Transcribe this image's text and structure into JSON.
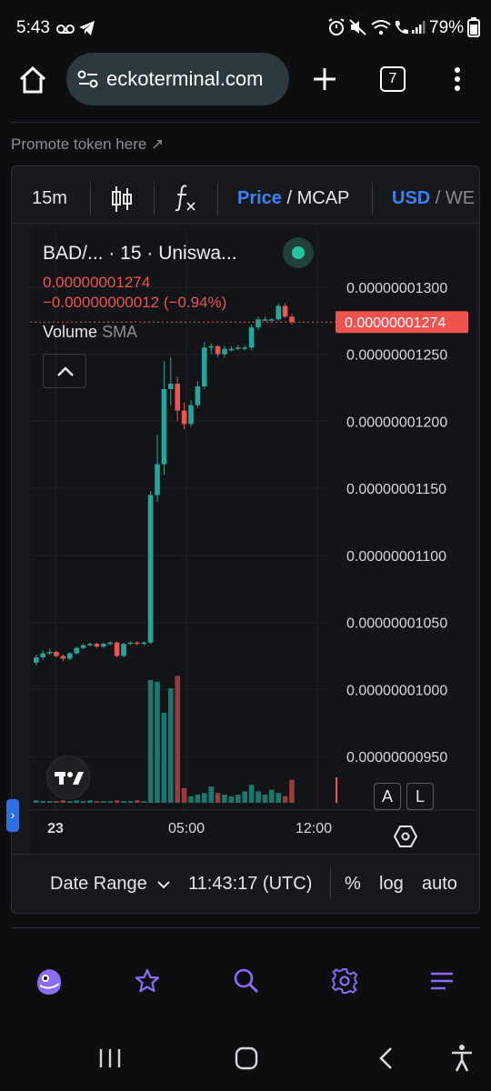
{
  "status_bar": {
    "time": "5:43",
    "battery": "79%"
  },
  "browser": {
    "url": "eckoterminal.com",
    "tab_count": "7"
  },
  "promote_link": "Promote token here ↗",
  "toolbar": {
    "interval": "15m",
    "price_label": "Price",
    "mcap_label": " / MCAP",
    "usd_label": "USD",
    "weth_label": " / WE"
  },
  "legend": {
    "symbol_line": "BAD/... · 15 · Uniswa...",
    "price": "0.00000001274",
    "change": "−0.00000000012 (−0.94%)",
    "volume_label": "Volume",
    "sma_label": "SMA"
  },
  "chart_data": {
    "type": "candlestick",
    "title": "",
    "ylim": [
      9.25e-09,
      1.325e-08
    ],
    "y_ticks": [
      "0.00000001300",
      "0.00000001250",
      "0.00000001200",
      "0.00000001150",
      "0.00000001100",
      "0.00000001050",
      "0.00000001000",
      "0.00000000950"
    ],
    "y_tick_values": [
      1300,
      1250,
      1200,
      1150,
      1100,
      1050,
      1000,
      950
    ],
    "x_ticks": [
      "23",
      "05:00",
      "12:00"
    ],
    "last_price_label": "0.00000001274",
    "last_price_value": 1274,
    "candles": [
      {
        "o": 1020,
        "c": 1024,
        "h": 1026,
        "l": 1018
      },
      {
        "o": 1024,
        "c": 1027,
        "h": 1029,
        "l": 1022
      },
      {
        "o": 1027,
        "c": 1028,
        "h": 1030,
        "l": 1026
      },
      {
        "o": 1028,
        "c": 1025,
        "h": 1029,
        "l": 1024
      },
      {
        "o": 1025,
        "c": 1023,
        "h": 1026,
        "l": 1021
      },
      {
        "o": 1023,
        "c": 1027,
        "h": 1028,
        "l": 1022
      },
      {
        "o": 1027,
        "c": 1031,
        "h": 1032,
        "l": 1026
      },
      {
        "o": 1031,
        "c": 1033,
        "h": 1034,
        "l": 1030
      },
      {
        "o": 1033,
        "c": 1034,
        "h": 1035,
        "l": 1032
      },
      {
        "o": 1034,
        "c": 1032,
        "h": 1035,
        "l": 1031
      },
      {
        "o": 1032,
        "c": 1034,
        "h": 1035,
        "l": 1031
      },
      {
        "o": 1034,
        "c": 1035,
        "h": 1036,
        "l": 1033
      },
      {
        "o": 1035,
        "c": 1025,
        "h": 1036,
        "l": 1024
      },
      {
        "o": 1025,
        "c": 1034,
        "h": 1035,
        "l": 1024
      },
      {
        "o": 1034,
        "c": 1035,
        "h": 1036,
        "l": 1033
      },
      {
        "o": 1035,
        "c": 1034,
        "h": 1036,
        "l": 1033
      },
      {
        "o": 1034,
        "c": 1035,
        "h": 1036,
        "l": 1033
      },
      {
        "o": 1035,
        "c": 1145,
        "h": 1148,
        "l": 1034
      },
      {
        "o": 1145,
        "c": 1168,
        "h": 1190,
        "l": 1140
      },
      {
        "o": 1168,
        "c": 1224,
        "h": 1245,
        "l": 1160
      },
      {
        "o": 1224,
        "c": 1228,
        "h": 1248,
        "l": 1212
      },
      {
        "o": 1228,
        "c": 1208,
        "h": 1233,
        "l": 1200
      },
      {
        "o": 1208,
        "c": 1198,
        "h": 1214,
        "l": 1194
      },
      {
        "o": 1198,
        "c": 1212,
        "h": 1216,
        "l": 1196
      },
      {
        "o": 1212,
        "c": 1226,
        "h": 1230,
        "l": 1210
      },
      {
        "o": 1226,
        "c": 1255,
        "h": 1259,
        "l": 1224
      },
      {
        "o": 1255,
        "c": 1256,
        "h": 1258,
        "l": 1250
      },
      {
        "o": 1256,
        "c": 1250,
        "h": 1257,
        "l": 1248
      },
      {
        "o": 1250,
        "c": 1254,
        "h": 1256,
        "l": 1248
      },
      {
        "o": 1254,
        "c": 1254,
        "h": 1256,
        "l": 1252
      },
      {
        "o": 1254,
        "c": 1255,
        "h": 1257,
        "l": 1253
      },
      {
        "o": 1255,
        "c": 1255,
        "h": 1257,
        "l": 1253
      },
      {
        "o": 1255,
        "c": 1270,
        "h": 1272,
        "l": 1253
      },
      {
        "o": 1270,
        "c": 1276,
        "h": 1278,
        "l": 1268
      },
      {
        "o": 1276,
        "c": 1276,
        "h": 1278,
        "l": 1275
      },
      {
        "o": 1276,
        "c": 1276,
        "h": 1277,
        "l": 1275
      },
      {
        "o": 1276,
        "c": 1286,
        "h": 1288,
        "l": 1275
      },
      {
        "o": 1286,
        "c": 1278,
        "h": 1288,
        "l": 1277
      },
      {
        "o": 1278,
        "c": 1274,
        "h": 1280,
        "l": 1272
      }
    ],
    "volumes": [
      3,
      2,
      2,
      2,
      3,
      2,
      3,
      2,
      3,
      2,
      2,
      2,
      3,
      2,
      2,
      3,
      2,
      150,
      148,
      110,
      140,
      155,
      18,
      8,
      10,
      12,
      20,
      12,
      10,
      8,
      10,
      14,
      22,
      14,
      10,
      16,
      12,
      8,
      28
    ]
  },
  "chart_controls": {
    "a_label": "A",
    "l_label": "L",
    "expand_arrow": "›"
  },
  "range_bar": {
    "date_range": "Date Range",
    "time": "11:43:17 (UTC)",
    "percent": "%",
    "log": "log",
    "auto": "auto"
  },
  "colors": {
    "up": "#26a69a",
    "down": "#ef5350",
    "accent": "#2f6fe4",
    "nav_accent": "#8b6cf6"
  }
}
